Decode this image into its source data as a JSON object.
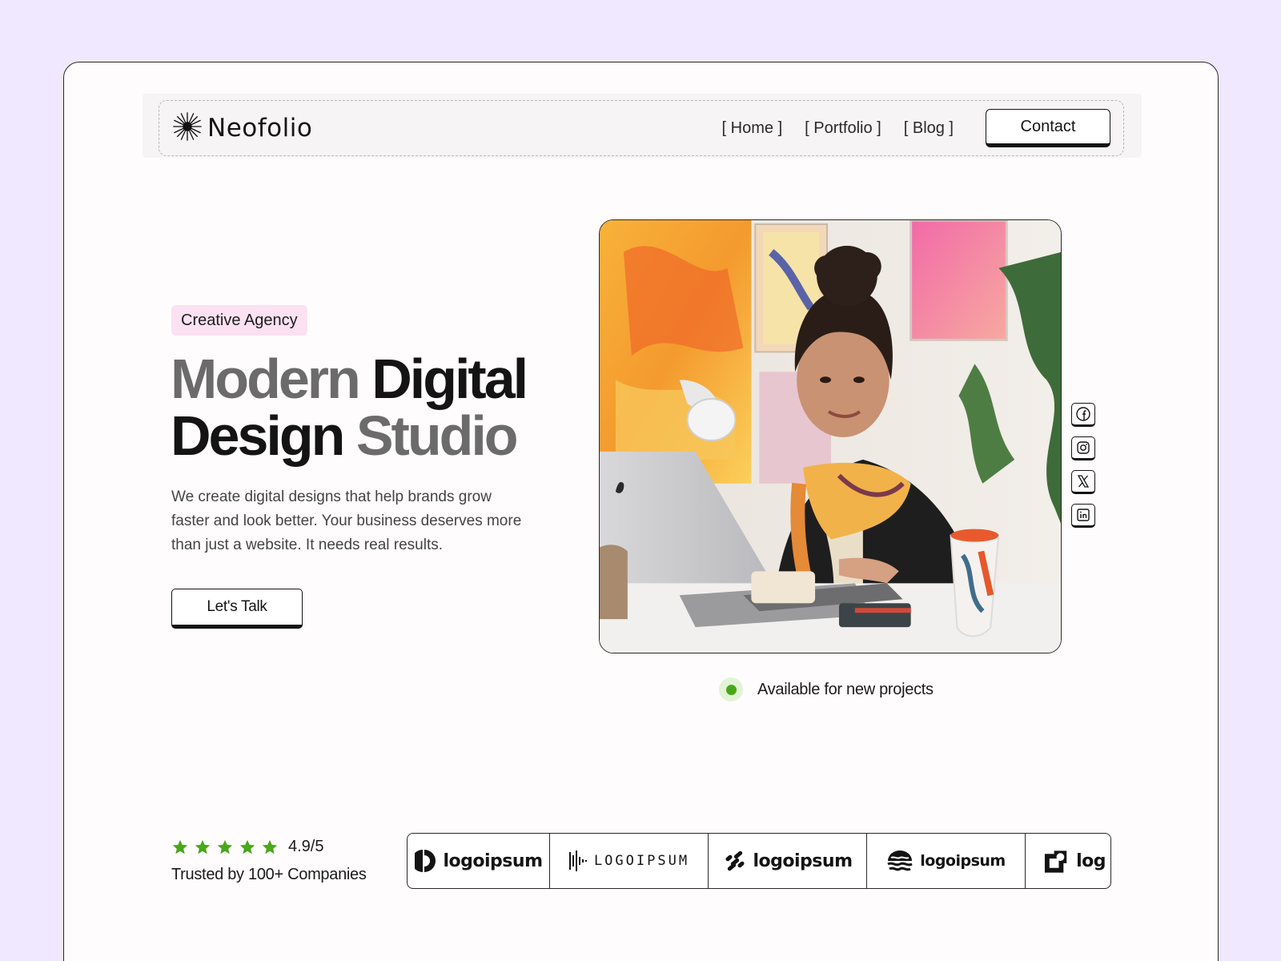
{
  "nav": {
    "brand": "Neofolio",
    "links": [
      "[ Home ]",
      "[ Portfolio ]",
      "[ Blog ]"
    ],
    "contact_label": "Contact"
  },
  "hero": {
    "badge": "Creative Agency",
    "headline": {
      "line1_muted": "Modern",
      "line1_dark": "Digital",
      "line2_dark": "Design",
      "line2_muted": "Studio"
    },
    "description": "We create digital designs that help brands grow faster and look better. Your business deserves more than just a website. It needs real results.",
    "cta_label": "Let's Talk",
    "status": "Available for new projects"
  },
  "socials": [
    "facebook-icon",
    "instagram-icon",
    "x-icon",
    "linkedin-icon"
  ],
  "trust": {
    "stars": 5,
    "rating": "4.9/5",
    "trusted_text": "Trusted by 100+ Companies",
    "logos": [
      "logoipsum",
      "LOGOIPSUM",
      "logoipsum",
      "logoipsum",
      "log"
    ]
  },
  "colors": {
    "page_bg": "#f0e8fe",
    "badge_bg": "#fbe1f1",
    "accent_green": "#49a81a",
    "muted_text": "#6b6b6b"
  }
}
